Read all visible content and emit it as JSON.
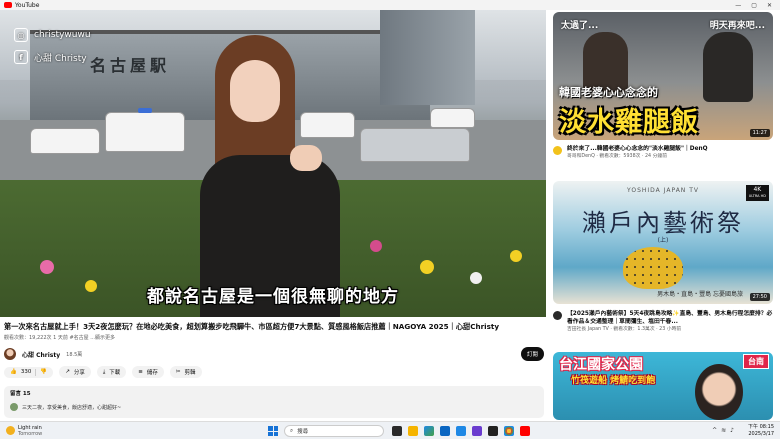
{
  "window": {
    "title": "YouTube"
  },
  "player": {
    "social_instagram": "christywuwu",
    "social_facebook": "心甜 Christy",
    "building_sign": "名古屋駅",
    "subtitle": "都說名古屋是一個很無聊的地方"
  },
  "video": {
    "title": "第一次來名古屋就上手！3天2夜怎麼玩？在地必吃美食，超划算搬步吃飛驒牛、市區超方便7大景點、質感風格飯店推薦｜NAGOYA 2025｜心甜Christy",
    "meta": "觀看次數：19,222次  1 天前  #名古屋  ...顯示更多",
    "channel": "心甜 Christy",
    "subscribers": "18.5萬",
    "subscribe_label": "訂閱",
    "likes": "330",
    "like_icon": "thumb-up-icon",
    "share_label": "分享",
    "download_label": "下載",
    "save_label": "儲存",
    "clip_label": "剪輯"
  },
  "comments": {
    "label": "留言 15",
    "preview": "三天二夜，享受美食，飯店舒適，心甜超好~"
  },
  "related": [
    {
      "thumb_top_left": "太過了...",
      "thumb_top_right": "明天再來吧...",
      "thumb_line1": "韓國老婆心心念念的",
      "thumb_line2": "淡水雞腿飯",
      "duration": "11:27",
      "title": "終於來了...韓國老婆心心念念的\"淡水雞腿飯\"｜DenQ",
      "meta": "哥哥和DenQ · 觀看次數：5938次 · 24 分鐘前",
      "avatar_color": "#f2c21b"
    },
    {
      "brand": "YOSHIDA JAPAN TV",
      "badge_top": "4K",
      "badge_bottom": "ULTRA HD",
      "thumb_title": "瀨戶內藝術祭",
      "thumb_sub": "(上)",
      "bottom_text": "男木島・直島・豐島 忘憂國島旅",
      "duration": "27:50",
      "title": "【2025瀨戶內藝術祭】5天4夜跳島攻略✨直島、豐島、男木島行程怎麼排？必看作品＆交通整理｜草間彌生、塩田千春...",
      "meta": "吉田社長 Japan TV · 觀看次數：1.3萬次 · 23 小時前",
      "avatar_color": "#2a2a2a"
    },
    {
      "thumb_banner": "台江國家公園",
      "thumb_tag": "台南",
      "thumb_sub": "竹筏遊船 烤鯖吃到飽",
      "duration": ""
    }
  ],
  "taskbar": {
    "weather_title": "Light rain",
    "weather_sub": "Tomorrow",
    "search_placeholder": "搜尋",
    "time": "下午 08:15",
    "date": "2025/3/17"
  },
  "colors": {
    "youtube_red": "#ff0000",
    "subscribe_bg": "#0f0f0f"
  }
}
